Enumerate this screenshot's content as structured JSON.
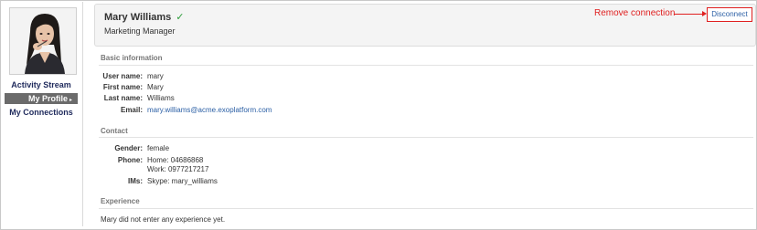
{
  "profile": {
    "name": "Mary Williams",
    "verified_icon": "check-icon",
    "job_title": "Marketing Manager",
    "disconnect_label": "Disconnect",
    "callout_label": "Remove connection"
  },
  "nav": {
    "activity": "Activity Stream",
    "profile": "My Profile",
    "connections": "My Connections"
  },
  "basic": {
    "title": "Basic information",
    "user_name_label": "User name:",
    "user_name": "mary",
    "first_name_label": "First name:",
    "first_name": "Mary",
    "last_name_label": "Last name:",
    "last_name": "Williams",
    "email_label": "Email:",
    "email": "mary.williams@acme.exoplatform.com"
  },
  "contact": {
    "title": "Contact",
    "gender_label": "Gender:",
    "gender": "female",
    "phone_label": "Phone:",
    "phone_home": "Home: 04686868",
    "phone_work": "Work: 0977217217",
    "ims_label": "IMs:",
    "ims": "Skype: mary_williams"
  },
  "experience": {
    "title": "Experience",
    "empty_text": "Mary did not enter any experience yet."
  },
  "colors": {
    "accent_red": "#e02020",
    "link_blue": "#2b5fa5",
    "verified_green": "#2e9e3b",
    "nav_active_bg": "#6b6b6b"
  }
}
